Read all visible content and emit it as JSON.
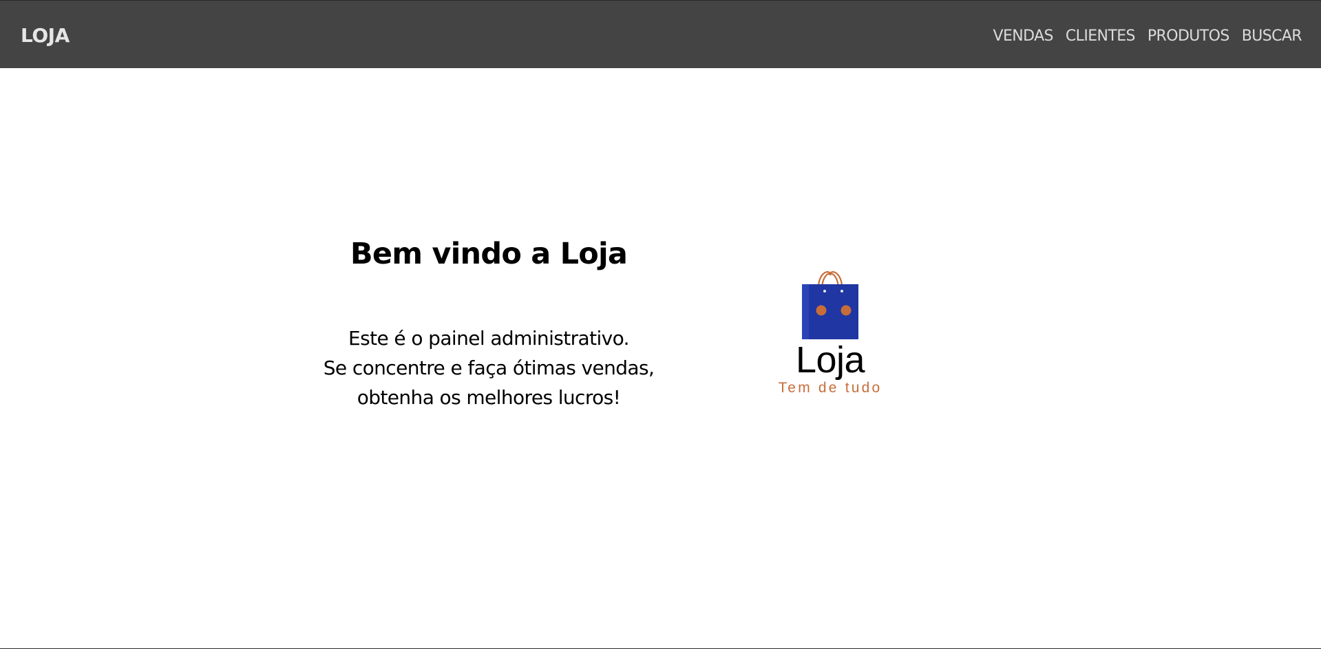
{
  "navbar": {
    "brand": "LOJA",
    "links": [
      {
        "label": "VENDAS"
      },
      {
        "label": "CLIENTES"
      },
      {
        "label": "PRODUTOS"
      },
      {
        "label": "BUSCAR"
      }
    ],
    "background_color": "#444444"
  },
  "main": {
    "title": "Bem vindo a Loja",
    "description_lines": [
      "Este é o painel administrativo.",
      "Se concentre e faça ótimas vendas,",
      "obtenha os melhores lucros!"
    ]
  },
  "logo": {
    "icon": "shopping-bag-icon",
    "name": "Loja",
    "tagline": "Tem de tudo",
    "bag_color": "#1f36a3",
    "accent_color": "#c76d3a"
  }
}
